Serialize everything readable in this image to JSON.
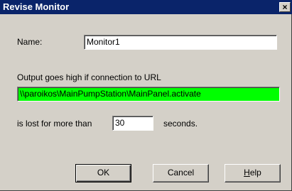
{
  "window": {
    "title": "Revise Monitor",
    "close_glyph": "×"
  },
  "form": {
    "name_label": "Name:",
    "name_value": "Monitor1",
    "output_label": "Output goes high if connection to URL",
    "url_value": "\\\\paroikos\\MainPumpStation\\MainPanel.activate",
    "lost_label": "is lost for more than",
    "seconds_value": "30",
    "seconds_label": "seconds."
  },
  "buttons": {
    "ok": "OK",
    "cancel": "Cancel",
    "help_mnemonic": "H",
    "help_rest": "elp"
  },
  "colors": {
    "titlebar": "#0a246a",
    "url_highlight": "#00ff00",
    "dialog_face": "#d4d0c8"
  }
}
